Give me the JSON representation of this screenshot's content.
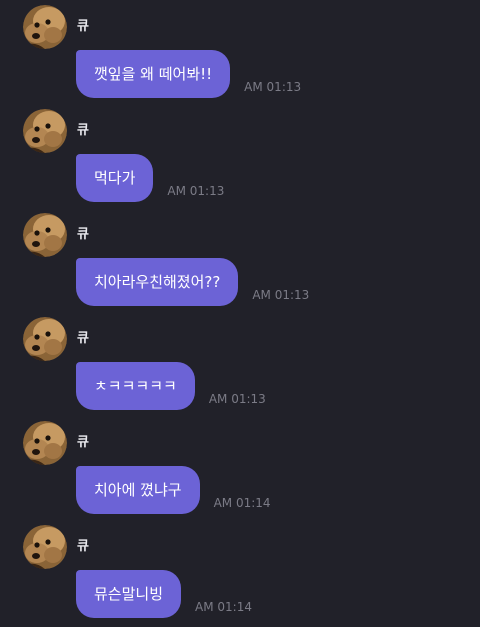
{
  "messages": [
    {
      "sender": "큐",
      "text": "깻잎을 왜 떼어봐!!",
      "time": "AM 01:13",
      "avatar_icon": "dog-avatar-icon"
    },
    {
      "sender": "큐",
      "text": "먹다가",
      "time": "AM 01:13",
      "avatar_icon": "dog-avatar-icon"
    },
    {
      "sender": "큐",
      "text": "치아라우친해졌어??",
      "time": "AM 01:13",
      "avatar_icon": "dog-avatar-icon"
    },
    {
      "sender": "큐",
      "text": "ㅊㅋㅋㅋㅋㅋ",
      "time": "AM 01:13",
      "avatar_icon": "dog-avatar-icon"
    },
    {
      "sender": "큐",
      "text": "치아에 꼈냐구",
      "time": "AM 01:14",
      "avatar_icon": "dog-avatar-icon"
    },
    {
      "sender": "큐",
      "text": "뮤슨말니빙",
      "time": "AM 01:14",
      "avatar_icon": "dog-avatar-icon"
    }
  ],
  "colors": {
    "background": "#212129",
    "bubble": "#6c63d6",
    "bubble_text": "#ffffff",
    "name_text": "#e9e9ee",
    "time_text": "#7b7b86"
  }
}
